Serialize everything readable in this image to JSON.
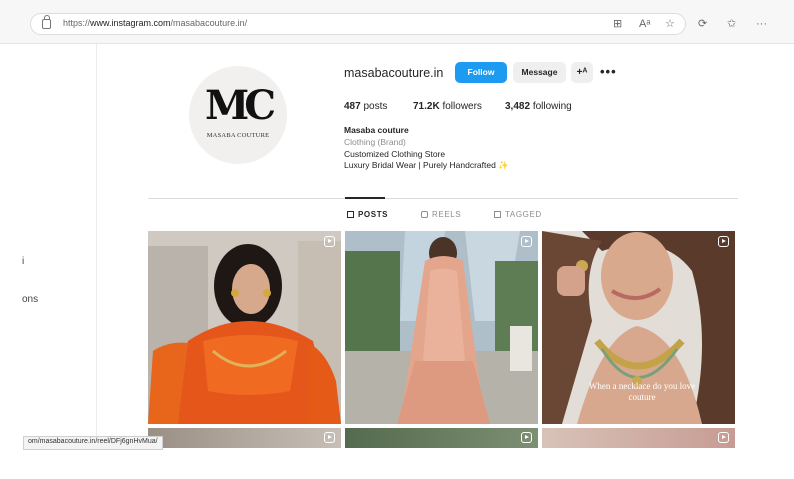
{
  "browser": {
    "url_prefix": "https://",
    "url_host": "www.instagram.com",
    "url_path": "/masabacouture.in/",
    "status_link": "om/masabacouture.in/reel/DFj6gnHvMua/"
  },
  "left_nav": {
    "fragment_1": "i",
    "fragment_2": "ons"
  },
  "profile": {
    "avatar_monogram": "MC",
    "avatar_brand": "MASABA COUTURE",
    "username": "masabacouture.in",
    "follow_label": "Follow",
    "message_label": "Message",
    "add_user_glyph": "+ᴬ",
    "more_glyph": "•••",
    "posts_count": "487",
    "posts_label": "posts",
    "followers_count": "71.2K",
    "followers_label": "followers",
    "following_count": "3,482",
    "following_label": "following",
    "bio_name": "Masaba couture",
    "bio_category": "Clothing (Brand)",
    "bio_line1": "Customized Clothing Store",
    "bio_line2": "Luxury Bridal Wear | Purely Handcrafted",
    "bio_emoji": "✨"
  },
  "tabs": [
    {
      "label": "POSTS"
    },
    {
      "label": "REELS"
    },
    {
      "label": "TAGGED"
    }
  ],
  "posts": {
    "p3_caption": "When a necklace do you love couture"
  },
  "colors": {
    "follow_button": "#1d9bf0",
    "accent_text": "#262626"
  }
}
